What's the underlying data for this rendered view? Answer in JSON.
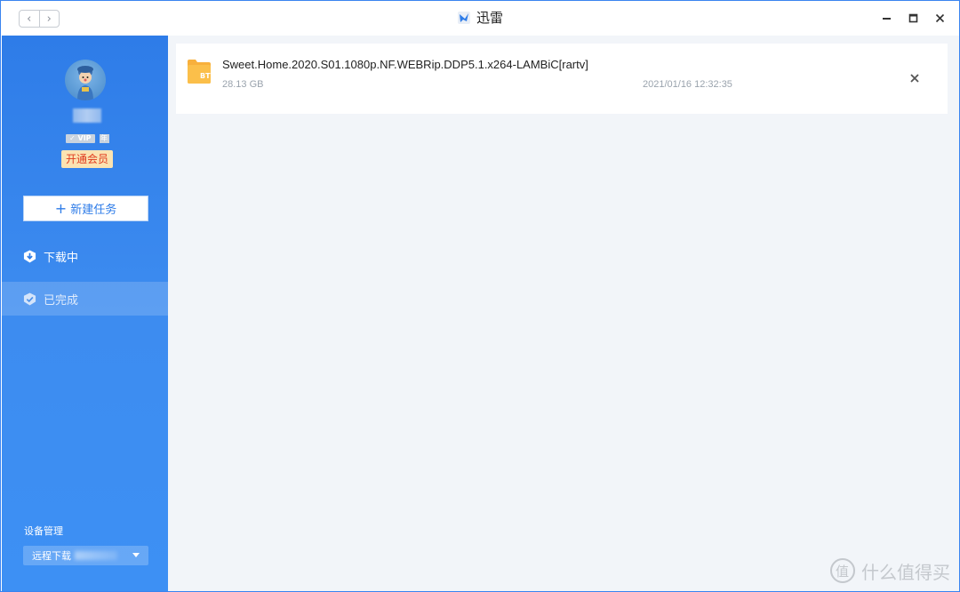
{
  "window": {
    "title": "迅雷",
    "controls": [
      "minimize-icon",
      "maximize-icon",
      "close-icon"
    ]
  },
  "nav": {
    "back_glyph": "‹",
    "forward_glyph": "›"
  },
  "profile": {
    "vip_badge": "VIP",
    "vip_mini": "年",
    "join_vip_label": "开通会员"
  },
  "sidebar": {
    "new_task_label": "新建任务",
    "new_task_icon": "+",
    "items": [
      {
        "label": "下载中",
        "icon": "download-shield-icon",
        "active": false
      },
      {
        "label": "已完成",
        "icon": "check-shield-icon",
        "active": true
      }
    ],
    "device_label": "设备管理",
    "device_select_value": "远程下载"
  },
  "tasks": [
    {
      "name": "Sweet.Home.2020.S01.1080p.NF.WEBRip.DDP5.1.x264-LAMBiC[rartv]",
      "size": "28.13 GB",
      "date": "2021/01/16 12:32:35",
      "file_type": "BT"
    }
  ],
  "watermark": {
    "text": "什么值得买",
    "logo_glyph": "值"
  },
  "colors": {
    "accent": "#2e7ce8",
    "sidebar_bg": "#3d8cf0",
    "main_bg": "#f2f5f9",
    "vip_text": "#e03a1e",
    "vip_bg": "#fbe3b2",
    "folder": "#f8b03c"
  }
}
